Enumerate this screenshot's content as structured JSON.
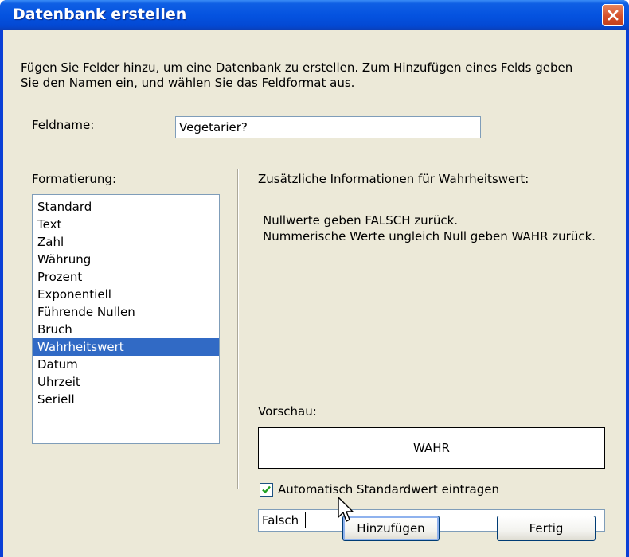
{
  "window": {
    "title": "Datenbank erstellen",
    "close_icon": "close-icon"
  },
  "intro_text": "Fügen Sie Felder hinzu, um eine Datenbank zu erstellen. Zum Hinzufügen eines Felds geben Sie den Namen ein, und wählen Sie das Feldformat aus.",
  "fieldname": {
    "label": "Feldname:",
    "value": "Vegetarier?"
  },
  "formatting": {
    "label": "Formatierung:",
    "items": [
      "Standard",
      "Text",
      "Zahl",
      "Währung",
      "Prozent",
      "Exponentiell",
      "Führende Nullen",
      "Bruch",
      "Wahrheitswert",
      "Datum",
      "Uhrzeit",
      "Seriell"
    ],
    "selected": "Wahrheitswert"
  },
  "info": {
    "heading": "Zusätzliche Informationen für Wahrheitswert:",
    "line1": "Nullwerte geben FALSCH zurück.",
    "line2": "Nummerische Werte ungleich Null geben WAHR zurück."
  },
  "preview": {
    "label": "Vorschau:",
    "value": "WAHR"
  },
  "auto_default": {
    "checked": true,
    "label": "Automatisch Standardwert eintragen",
    "value": "Falsch"
  },
  "buttons": {
    "add": "Hinzufügen",
    "done": "Fertig"
  },
  "colors": {
    "title_bar": "#0553e0",
    "selection": "#316ac5",
    "close_button": "#d5502b",
    "dialog_face": "#ece9d8"
  }
}
